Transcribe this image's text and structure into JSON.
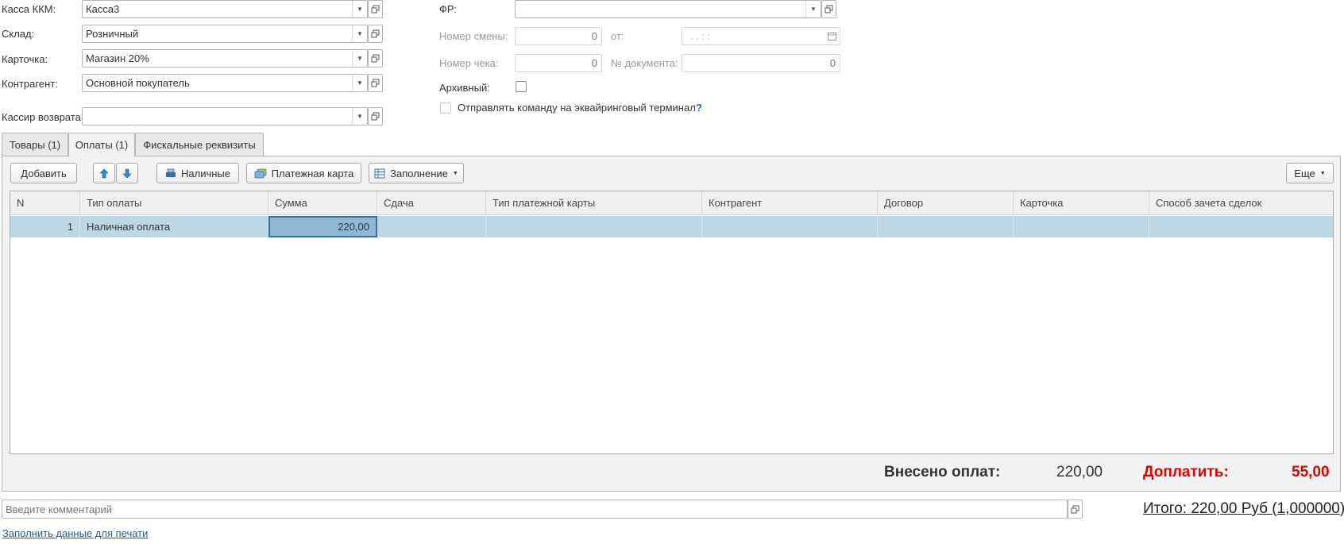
{
  "header_left": {
    "kassa_label": "Касса ККМ:",
    "kassa_value": "Касса3",
    "sklad_label": "Склад:",
    "sklad_value": "Розничный",
    "kartochka_label": "Карточка:",
    "kartochka_value": "Магазин 20%",
    "kontragent_label": "Контрагент:",
    "kontragent_value": "Основной покупатель",
    "kassir_label": "Кассир возврата:",
    "kassir_value": ""
  },
  "header_right": {
    "fr_label": "ФР:",
    "fr_value": "",
    "shift_label": "Номер смены:",
    "shift_value": "0",
    "ot_label": "от:",
    "ot_value": " .  .         :  :",
    "check_label": "Номер чека:",
    "check_value": "0",
    "doc_label": "№ документа:",
    "doc_value": "0",
    "archive_label": "Архивный:",
    "archive_checked": false,
    "terminal_label": "Отправлять команду на эквайринговый терминал",
    "terminal_help": "?",
    "terminal_checked": false
  },
  "tabs": [
    {
      "label": "Товары (1)",
      "active": false
    },
    {
      "label": "Оплаты (1)",
      "active": true
    },
    {
      "label": "Фискальные реквизиты",
      "active": false
    }
  ],
  "toolbar": {
    "add_label": "Добавить",
    "cash_label": "Наличные",
    "card_label": "Платежная карта",
    "fill_label": "Заполнение",
    "more_label": "Еще"
  },
  "table": {
    "headers": [
      "N",
      "Тип оплаты",
      "Сумма",
      "Сдача",
      "Тип платежной карты",
      "Контрагент",
      "Договор",
      "Карточка",
      "Способ зачета сделок"
    ],
    "rows": [
      {
        "n": "1",
        "type": "Наличная оплата",
        "sum": "220,00",
        "change": "",
        "card_type": "",
        "kontragent": "",
        "dogovor": "",
        "kartochka": "",
        "sposob": ""
      }
    ]
  },
  "totals": {
    "paid_label": "Внесено оплат:",
    "paid_value": "220,00",
    "due_label": "Доплатить:",
    "due_value": "55,00",
    "due_color": "#e00000"
  },
  "footer": {
    "comment_placeholder": "Введите комментарий",
    "itogo": "Итого: 220,00 Руб (1,000000)",
    "print_link": "Заполнить данные для печати"
  },
  "icons": {
    "dropdown": "triangle-down",
    "open": "open-window-icon",
    "calendar": "calendar-icon",
    "up": "arrow-up-icon",
    "down": "arrow-down-icon"
  }
}
